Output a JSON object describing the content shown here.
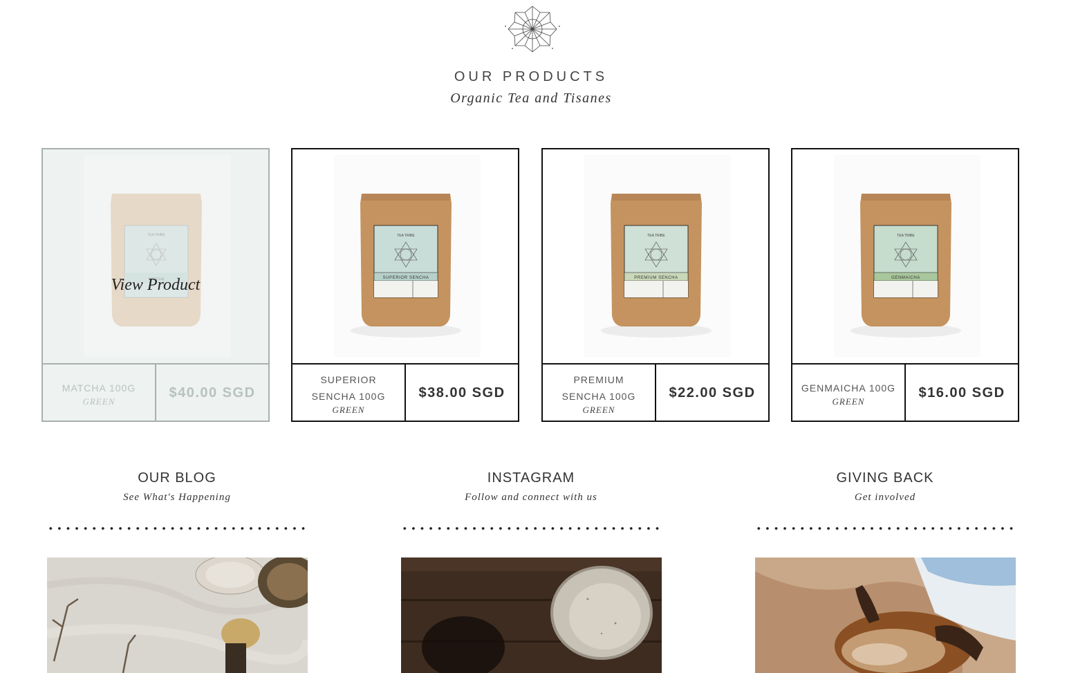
{
  "header": {
    "title": "OUR PRODUCTS",
    "subtitle": "Organic Tea and Tisanes"
  },
  "products": [
    {
      "name": "MATCHA 100G",
      "category": "GREEN",
      "price": "$40.00 SGD",
      "label": "MATCHA",
      "overlay": "View Product",
      "hover": true
    },
    {
      "name": "SUPERIOR SENCHA 100G",
      "category": "GREEN",
      "price": "$38.00 SGD",
      "label": "SUPERIOR SENCHA"
    },
    {
      "name": "PREMIUM SENCHA 100G",
      "category": "GREEN",
      "price": "$22.00 SGD",
      "label": "PREMIUM SENCHA"
    },
    {
      "name": "GENMAICHA 100G",
      "category": "GREEN",
      "price": "$16.00 SGD",
      "label": "GENMAICHA"
    }
  ],
  "pouch": {
    "brand": "TEA TRIBE"
  },
  "sections": [
    {
      "title": "OUR BLOG",
      "subtitle": "See What's Happening"
    },
    {
      "title": "INSTAGRAM",
      "subtitle": "Follow and connect with us"
    },
    {
      "title": "GIVING BACK",
      "subtitle": "Get involved"
    }
  ],
  "colors": {
    "border": "#111111",
    "hover_bg": "#eef2f0",
    "kraft": "#c4935f",
    "label_mint": "#c9ddd8"
  }
}
